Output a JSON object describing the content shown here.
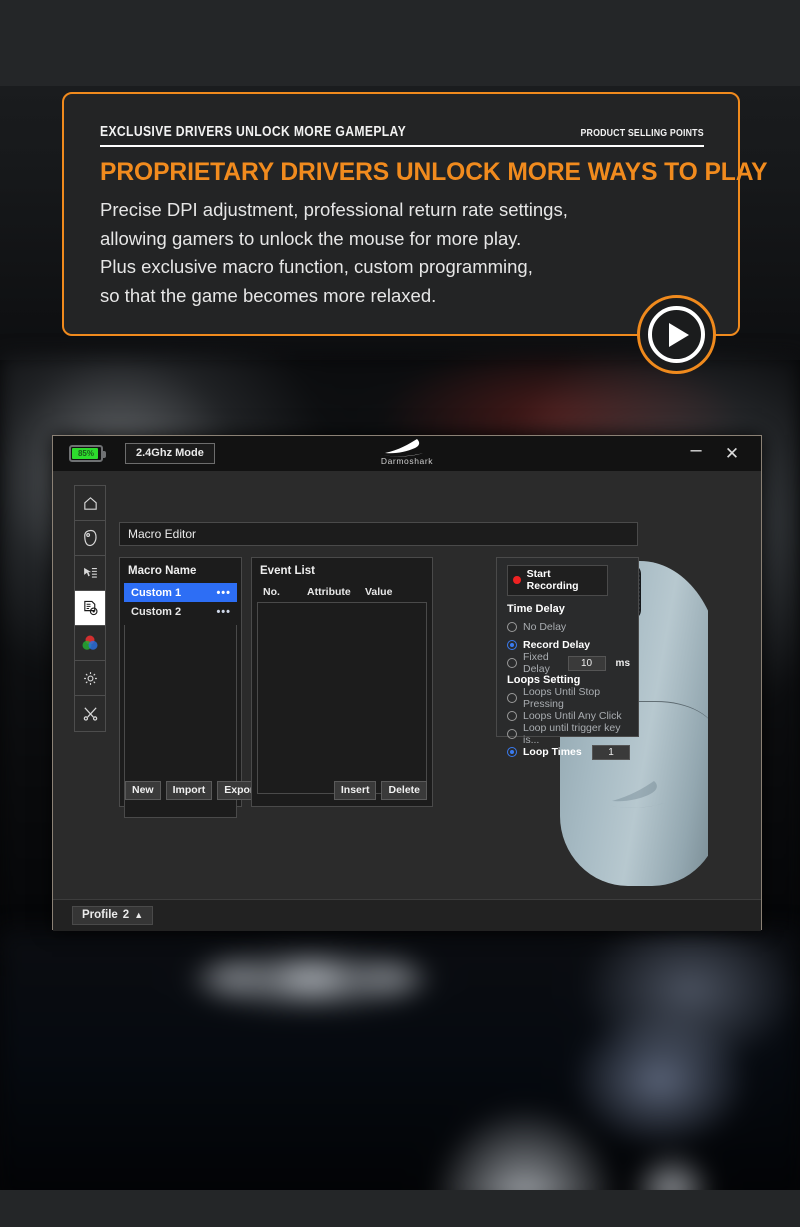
{
  "banner": {
    "kicker_left": "EXCLUSIVE DRIVERS UNLOCK MORE GAMEPLAY",
    "kicker_right": "PRODUCT SELLING POINTS",
    "headline": "PROPRIETARY DRIVERS UNLOCK MORE WAYS TO PLAY",
    "body_lines": [
      "Precise DPI adjustment, professional return rate settings,",
      "allowing gamers to unlock the mouse for more play.",
      "Plus exclusive macro function, custom programming,",
      "so that the game becomes more relaxed."
    ],
    "accent_color": "#f08a1d",
    "play_icon": "play-icon"
  },
  "app": {
    "titlebar": {
      "battery_percent": "85%",
      "battery_color": "#2ddc2d",
      "mode_label": "2.4Ghz Mode",
      "brand_name": "Darmoshark",
      "brand_icon": "shark-fin-icon",
      "minimize_label": "–",
      "close_label": "✕"
    },
    "sidebar": {
      "items": [
        {
          "icon": "home-icon",
          "name": "sidebar-item-home",
          "active": false
        },
        {
          "icon": "mouse-icon",
          "name": "sidebar-item-mouse",
          "active": false
        },
        {
          "icon": "key-assign-icon",
          "name": "sidebar-item-key-assign",
          "active": false
        },
        {
          "icon": "macro-icon",
          "name": "sidebar-item-macro",
          "active": true
        },
        {
          "icon": "rgb-lighting-icon",
          "name": "sidebar-item-lighting",
          "active": false
        },
        {
          "icon": "gear-icon",
          "name": "sidebar-item-settings",
          "active": false
        },
        {
          "icon": "tools-icon",
          "name": "sidebar-item-tools",
          "active": false
        }
      ]
    },
    "page_title": "Macro Editor",
    "macro_panel": {
      "title": "Macro Name",
      "items": [
        {
          "label": "Custom 1",
          "menu": "•••",
          "selected": true
        },
        {
          "label": "Custom 2",
          "menu": "•••",
          "selected": false
        }
      ],
      "buttons": [
        "New",
        "Import",
        "Export"
      ],
      "selected_color": "#2d6ef5"
    },
    "event_panel": {
      "title": "Event List",
      "columns": [
        "No.",
        "Attribute",
        "Value"
      ],
      "rows": [],
      "buttons": [
        "Insert",
        "Delete"
      ]
    },
    "options_panel": {
      "record_button": "Start Recording",
      "record_dot_color": "#ee2222",
      "time_delay": {
        "title": "Time Delay",
        "options": [
          {
            "label": "No Delay",
            "selected": false
          },
          {
            "label": "Record Delay",
            "selected": true
          },
          {
            "label": "Fixed Delay",
            "selected": false,
            "value": "10",
            "unit": "ms"
          }
        ]
      },
      "loops_setting": {
        "title": "Loops Setting",
        "options": [
          {
            "label": "Loops Until Stop Pressing",
            "selected": false
          },
          {
            "label": "Loops Until Any Click",
            "selected": false
          },
          {
            "label": "Loop until trigger key is...",
            "selected": false
          },
          {
            "label": "Loop Times",
            "selected": true,
            "value": "1"
          }
        ]
      }
    },
    "statusbar": {
      "profile_label": "Profile",
      "profile_number": "2",
      "profile_caret": "▲"
    }
  }
}
